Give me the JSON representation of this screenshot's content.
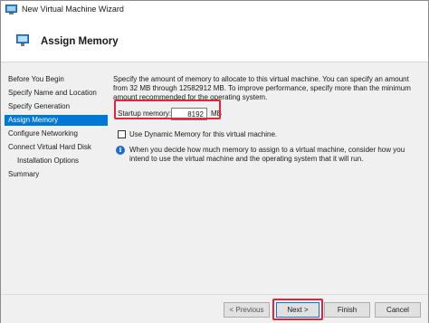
{
  "window": {
    "title": "New Virtual Machine Wizard",
    "icon": "hyper-v-monitor-icon"
  },
  "header": {
    "title": "Assign Memory",
    "icon": "memory-monitor-icon"
  },
  "nav": {
    "items": [
      {
        "label": "Before You Begin",
        "active": false,
        "indent": false
      },
      {
        "label": "Specify Name and Location",
        "active": false,
        "indent": false
      },
      {
        "label": "Specify Generation",
        "active": false,
        "indent": false
      },
      {
        "label": "Assign Memory",
        "active": true,
        "indent": false
      },
      {
        "label": "Configure Networking",
        "active": false,
        "indent": false
      },
      {
        "label": "Connect Virtual Hard Disk",
        "active": false,
        "indent": false
      },
      {
        "label": "Installation Options",
        "active": false,
        "indent": true
      },
      {
        "label": "Summary",
        "active": false,
        "indent": false
      }
    ]
  },
  "main": {
    "description": "Specify the amount of memory to allocate to this virtual machine. You can specify an amount from 32 MB through 12582912 MB. To improve performance, specify more than the minimum amount recommended for the operating system.",
    "startup_memory": {
      "label": "Startup memory:",
      "value": "8192",
      "unit": "MB"
    },
    "dynamic_memory": {
      "label": "Use Dynamic Memory for this virtual machine.",
      "checked": false
    },
    "info": {
      "icon": "info-icon",
      "glyph": "i",
      "text": "When you decide how much memory to assign to a virtual machine, consider how you intend to use the virtual machine and the operating system that it will run."
    }
  },
  "footer": {
    "previous_label": "< Previous",
    "next_label": "Next >",
    "finish_label": "Finish",
    "cancel_label": "Cancel"
  },
  "colors": {
    "accent": "#0078d7",
    "highlight": "#e0273a",
    "panel_bg": "#f0f0f0"
  }
}
